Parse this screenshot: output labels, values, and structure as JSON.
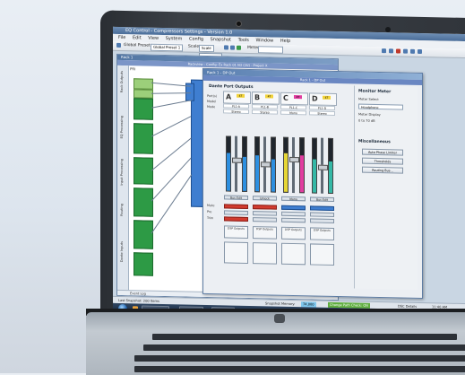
{
  "window": {
    "title": "EQ Control - Compressors Settings - Version 1.0"
  },
  "menubar": {
    "items": [
      "File",
      "Edit",
      "View",
      "System",
      "Config",
      "Snapshot",
      "Tools",
      "Window",
      "Help"
    ]
  },
  "toolbar": {
    "global_preset": "Global Preset",
    "global_preset_value": "Global Preset 1",
    "scale_label": "Scale:",
    "scale_value": "Scale",
    "dropdown_option": "Cinema",
    "meter_label": "Meter:"
  },
  "workspace": {
    "title": "Rack 1",
    "header": "Rackview - Config: Ex Rack 01 N3 (2U) - Project X",
    "sub": "PRI",
    "side_labels": [
      "Rack Outputs",
      "EQ Processing",
      "Input Processing",
      "Routing",
      "Dante Inputs"
    ],
    "footer": "Event Log"
  },
  "panel": {
    "title": "Rack 1 - DP Out",
    "header": "Rack 1 - DP Out",
    "section": "Dante Port Outputs",
    "row_labels": [
      "Port(s)",
      "Model",
      "Mode"
    ],
    "row_labels_lower": [
      "Mute",
      "Pre",
      "Trim"
    ],
    "channels": [
      {
        "letter": "A",
        "badge": "4T",
        "badge_color": "#f2d33a",
        "line1": "PL1-A",
        "line2": "Stereo",
        "meter_color": "#2d8fe0",
        "btn": "Bus Edit",
        "button_color": "red"
      },
      {
        "letter": "B",
        "badge": "4T",
        "badge_color": "#f2d33a",
        "line1": "PL1-B",
        "line2": "Stereo",
        "meter_color": "#2d8fe0",
        "btn": "Unlock",
        "button_color": "red"
      },
      {
        "letter": "C",
        "badge": "4T",
        "badge_color": "#e13c9f",
        "line1": "PL1-C",
        "line2": "Mono",
        "meter_color": "#e6d636",
        "btn": "Mono",
        "button_color": "blue"
      },
      {
        "letter": "D",
        "badge": "4T",
        "badge_color": "#f2d33a",
        "line1": "PL1-D",
        "line2": "Stereo",
        "meter_color": "#35b8a6",
        "btn": "Bus Edit",
        "button_color": "blue"
      }
    ],
    "dsp_label": "DSP Outputs",
    "right": {
      "monitor_title": "Monitor Meter",
      "meter_select_label": "Meter Select",
      "meter_select_value": "Headphone",
      "meter_display_label": "Meter Display",
      "meter_display_value": "0 to 70 dB",
      "misc_title": "Miscellaneous",
      "buttons": [
        "Auto Phase Limiter",
        "Thresholds",
        "Routing Bus..."
      ]
    }
  },
  "status": {
    "left": "Last Snapshot: 200 Items",
    "snapshot_label": "Snapshot Memory:",
    "snapshot_value": "74,000",
    "change_text": "Change Path Check: ON",
    "dsp_label": "DSC Details",
    "time": "11:40 AM"
  },
  "taskbar": {
    "items": [
      "DD Control-IF",
      "DD Control",
      "EQ-Control"
    ],
    "clock": "11:40 AM"
  }
}
